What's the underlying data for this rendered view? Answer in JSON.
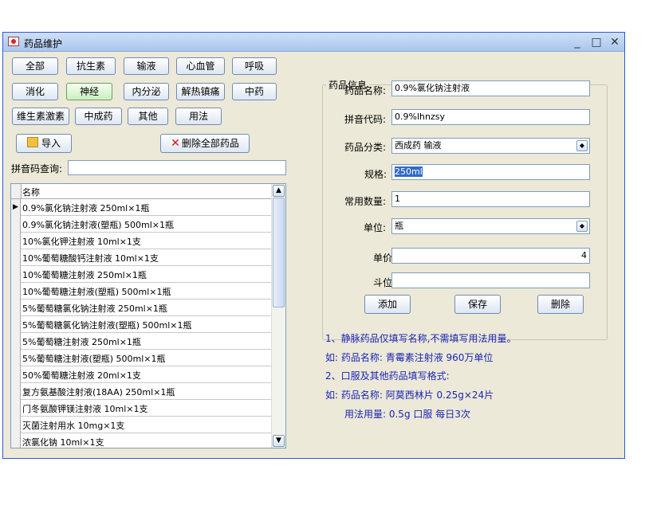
{
  "window": {
    "title": "药品维护",
    "min": "_",
    "max": "□",
    "close": "✕"
  },
  "categories": [
    {
      "label": "全部",
      "active": false
    },
    {
      "label": "抗生素",
      "active": false
    },
    {
      "label": "输液",
      "active": false
    },
    {
      "label": "心血管",
      "active": false
    },
    {
      "label": "呼吸",
      "active": false
    },
    {
      "label": "消化",
      "active": false
    },
    {
      "label": "神经",
      "active": true
    },
    {
      "label": "内分泌",
      "active": false
    },
    {
      "label": "解热镇痛",
      "active": false
    },
    {
      "label": "中药",
      "active": false
    },
    {
      "label": "维生素激素",
      "active": false
    },
    {
      "label": "中成药",
      "active": false
    },
    {
      "label": "其他",
      "active": false
    },
    {
      "label": "用法",
      "active": false
    }
  ],
  "toolbar": {
    "import_label": "导入",
    "delete_all_label": "删除全部药品"
  },
  "search": {
    "label": "拼音码查询:",
    "value": ""
  },
  "grid": {
    "header": "名称",
    "selected_marker": "▶",
    "rows": [
      "0.9%氯化钠注射液 250ml×1瓶",
      "0.9%氯化钠注射液(塑瓶) 500ml×1瓶",
      "10%氯化钾注射液 10ml×1支",
      "10%葡萄糖酸钙注射液 10ml×1支",
      "10%葡萄糖注射液 250ml×1瓶",
      "10%葡萄糖注射液(塑瓶) 500ml×1瓶",
      "5%葡萄糖氯化钠注射液 250ml×1瓶",
      "5%葡萄糖氯化钠注射液(塑瓶) 500ml×1瓶",
      "5%葡萄糖注射液 250ml×1瓶",
      "5%葡萄糖注射液(塑瓶) 500ml×1瓶",
      "50%葡萄糖注射液 20ml×1支",
      "复方氨基酸注射液(18AA) 250ml×1瓶",
      "门冬氨酸钾镁注射液 10ml×1支",
      "灭菌注射用水 10mg×1支",
      "浓氯化钠 10ml×1支"
    ]
  },
  "info": {
    "legend": "药品信息",
    "name_label": "药品名称:",
    "name_value": "0.9%氯化钠注射液",
    "pinyin_label": "拼音代码:",
    "pinyin_value": "0.9%lhnzsy",
    "category_label": "药品分类:",
    "category_value": "西成药 输液",
    "spec_label": "规格:",
    "spec_value": "250ml",
    "qty_label": "常用数量:",
    "qty_value": "1",
    "unit_label": "单位:",
    "unit_value": "瓶",
    "price_label": "单价:",
    "price_value": "4",
    "dou_label": "斗位:",
    "dou_value": "",
    "add_label": "添加",
    "save_label": "保存",
    "delete_label": "删除"
  },
  "notes": [
    "1、静脉药品仅填写名称,不需填写用法用量。",
    "如: 药品名称: 青霉素注射液 960万单位",
    "2、口服及其他药品填写格式:",
    "如: 药品名称: 阿莫西林片 0.25g×24片",
    "用法用量: 0.5g 口服 每日3次"
  ]
}
